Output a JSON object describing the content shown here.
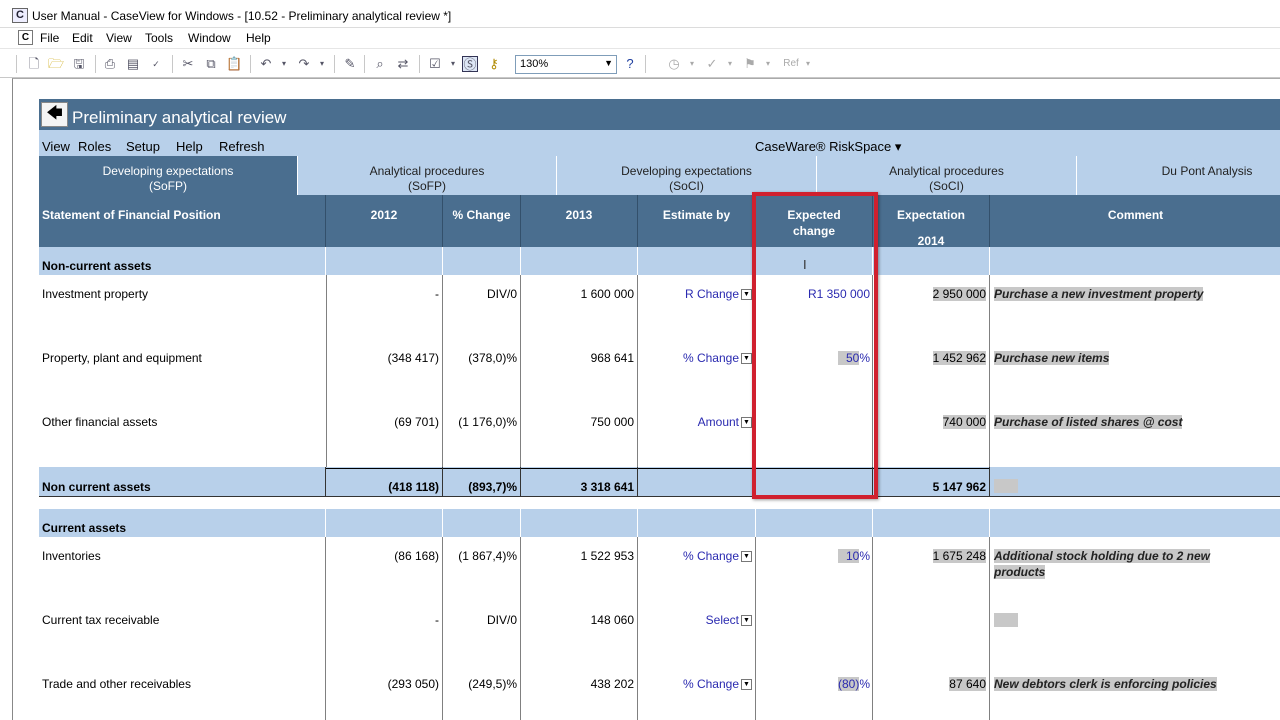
{
  "window": {
    "title": "User Manual - CaseView for Windows - [10.52 - Preliminary analytical review *]",
    "app_icon": "C"
  },
  "menu": {
    "mdi_icon": "C",
    "items": [
      "File",
      "Edit",
      "View",
      "Tools",
      "Window",
      "Help"
    ]
  },
  "toolbar": {
    "zoom_value": "130%"
  },
  "page": {
    "title": "Preliminary analytical review",
    "back_icon": "🡄"
  },
  "nav": {
    "items": [
      "View",
      "Roles",
      "Setup",
      "Help",
      "Refresh"
    ],
    "riskspace": "CaseWare® RiskSpace ▾"
  },
  "tabs": [
    {
      "line1": "Developing expectations",
      "line2": "(SoFP)"
    },
    {
      "line1": "Analytical procedures",
      "line2": "(SoFP)"
    },
    {
      "line1": "Developing expectations",
      "line2": "(SoCI)"
    },
    {
      "line1": "Analytical procedures",
      "line2": "(SoCI)"
    },
    {
      "line1": "Du Pont Analysis",
      "line2": ""
    }
  ],
  "table": {
    "headers": {
      "label": "Statement of Financial Position",
      "y2012": "2012",
      "pct": "% Change",
      "y2013": "2013",
      "estimate": "Estimate by",
      "expected": "Expected change",
      "expectation": "Expectation",
      "exp_year": "2014",
      "comment": "Comment"
    },
    "sections": {
      "noncurrent": "Non-current assets",
      "current": "Current assets"
    },
    "rows": [
      {
        "label": "Investment property",
        "y2012": "-",
        "pct": "DIV/0",
        "y2013": "1 600 000",
        "estimate": "R Change",
        "expected": "R1 350 000",
        "expectation": "2 950 000",
        "comment": "Purchase a new investment property"
      },
      {
        "label": "Property, plant and equipment",
        "y2012": "(348 417)",
        "pct": "(378,0)%",
        "y2013": "968 641",
        "estimate": "% Change",
        "expected": "50",
        "expectation": "1 452 962",
        "comment": "Purchase new items"
      },
      {
        "label": "Other financial assets",
        "y2012": "(69 701)",
        "pct": "(1 176,0)%",
        "y2013": "750 000",
        "estimate": "Amount",
        "expected": "",
        "expectation": "740 000",
        "comment": "Purchase of listed shares @ cost"
      },
      {
        "label": "Inventories",
        "y2012": "(86 168)",
        "pct": "(1 867,4)%",
        "y2013": "1 522 953",
        "estimate": "% Change",
        "expected": "10",
        "expectation": "1 675 248",
        "comment_1": "Additional stock holding due to 2 new",
        "comment_2": "products"
      },
      {
        "label": "Current tax receivable",
        "y2012": "-",
        "pct": "DIV/0",
        "y2013": "148 060",
        "estimate": "Select",
        "expected": "",
        "expectation": "",
        "comment": ""
      },
      {
        "label": "Trade and other receivables",
        "y2012": "(293 050)",
        "pct": "(249,5)%",
        "y2013": "438 202",
        "estimate": "% Change",
        "expected": "(80)",
        "expectation": "87 640",
        "comment": "New debtors clerk is enforcing policies"
      }
    ],
    "total": {
      "label": "Non current assets",
      "y2012": "(418 118)",
      "pct": "(893,7)%",
      "y2013": "3 318 641",
      "expectation": "5 147 962"
    },
    "pct_sign": "%"
  },
  "colors": {
    "header_bg": "#4a6e8f",
    "section_bg": "#b8d0ea",
    "highlight": "#d0202e",
    "input_text": "#2a2ab0"
  }
}
